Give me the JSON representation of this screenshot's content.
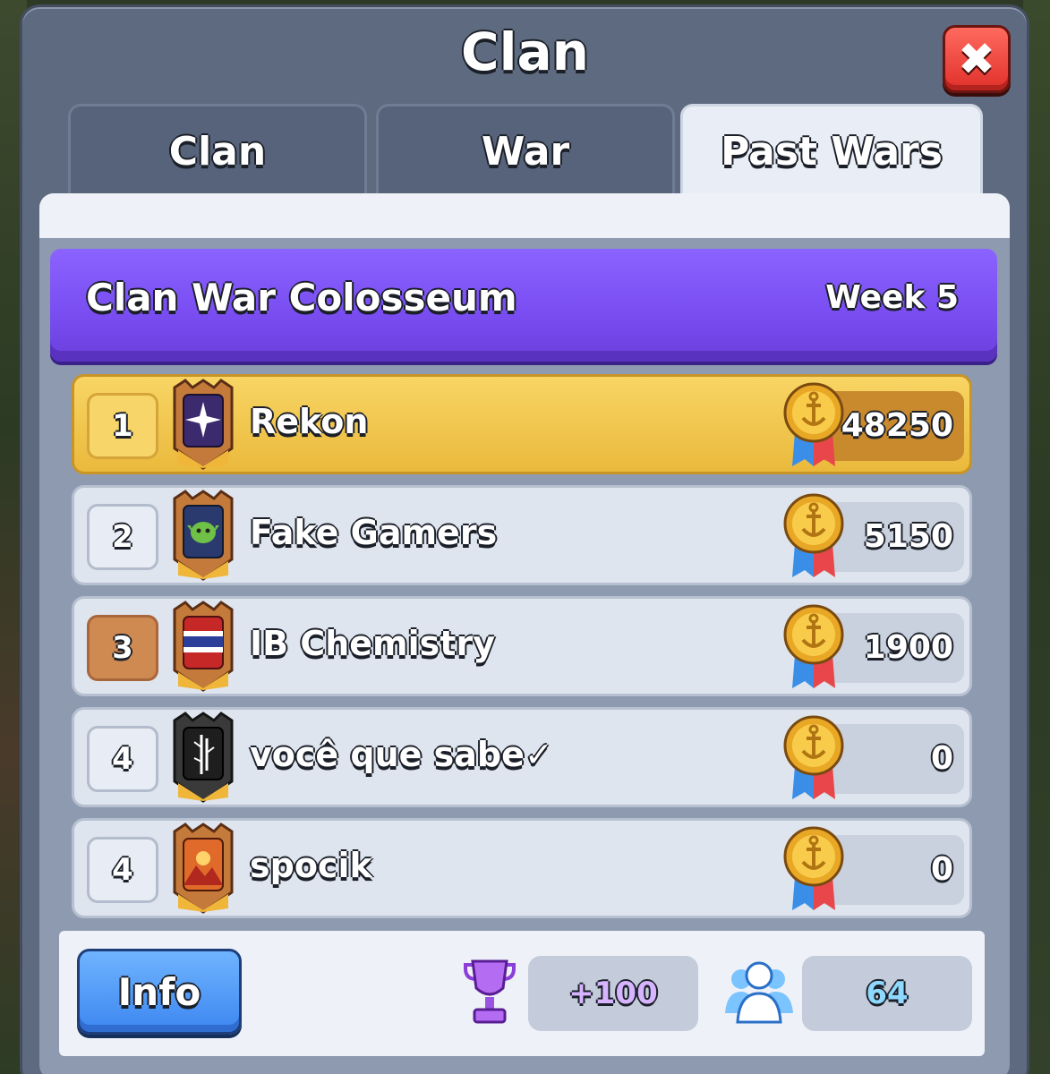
{
  "window": {
    "title": "Clan"
  },
  "tabs": [
    {
      "label": "Clan",
      "active": false
    },
    {
      "label": "War",
      "active": false
    },
    {
      "label": "Past Wars",
      "active": true
    }
  ],
  "banner": {
    "title": "Clan War Colosseum",
    "week": "Week 5"
  },
  "leaderboard": [
    {
      "rank": "1",
      "name": "Rekon",
      "score": "48250",
      "rank_style": "gold",
      "badge_icon": "star-burst-icon"
    },
    {
      "rank": "2",
      "name": "Fake Gamers",
      "score": "5150",
      "rank_style": "silver",
      "badge_icon": "goblin-icon"
    },
    {
      "rank": "3",
      "name": "IB Chemistry",
      "score": "1900",
      "rank_style": "bronze",
      "badge_icon": "striped-flag-icon"
    },
    {
      "rank": "4",
      "name": "você que sabe✓",
      "score": "0",
      "rank_style": "silver",
      "badge_icon": "bamboo-icon"
    },
    {
      "rank": "4",
      "name": "spocik",
      "score": "0",
      "rank_style": "silver",
      "badge_icon": "mountain-sunset-icon"
    }
  ],
  "footer": {
    "info_label": "Info",
    "trophy_value": "+100",
    "members_value": "64"
  },
  "colors": {
    "banner": "#7a4ef2",
    "gold_row": "#f0c64a",
    "info_button": "#3d86f0",
    "trophy_text": "#d6b4ff",
    "members_text": "#8fd8ff"
  }
}
